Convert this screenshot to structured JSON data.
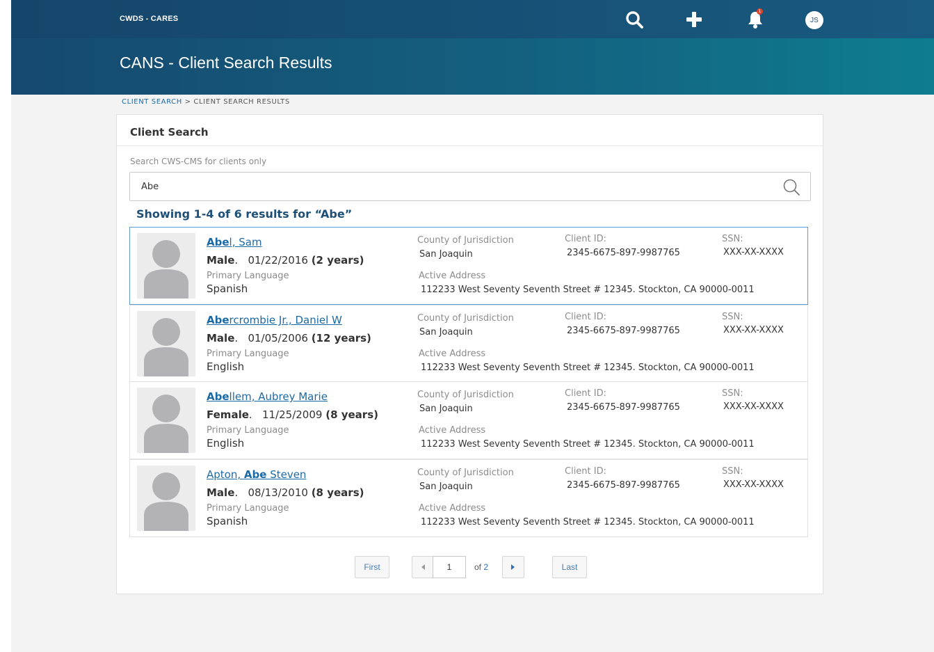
{
  "app": {
    "brand": "CWDS - CARES",
    "user_initials": "JS",
    "notification_count": "1"
  },
  "page": {
    "title": "CANS - Client Search Results"
  },
  "breadcrumb": {
    "link": "CLIENT SEARCH",
    "separator": " > ",
    "current": "CLIENT SEARCH RESULTS"
  },
  "search": {
    "card_title": "Client Search",
    "label": "Search CWS-CMS for clients only",
    "value": "Abe",
    "results_summary": "Showing 1-4 of 6 results for “Abe”"
  },
  "labels": {
    "primary_language": "Primary Language",
    "county": "County of Jurisdiction",
    "client_id": "Client ID:",
    "ssn": "SSN:",
    "address": "Active Address"
  },
  "results": [
    {
      "name_pre": "",
      "name_match": "Abe",
      "name_post": "l, Sam",
      "sex": "Male",
      "dob": "01/22/2016",
      "age": "(2 years)",
      "language": "Spanish",
      "county": "San Joaquin",
      "client_id": "2345-6675-897-9987765",
      "ssn": "XXX-XX-XXXX",
      "address": "112233 West Seventy Seventh Street # 12345. Stockton, CA 90000-0011",
      "selected": true
    },
    {
      "name_pre": "",
      "name_match": "Abe",
      "name_post": "rcrombie Jr., Daniel  W",
      "sex": "Male",
      "dob": "01/05/2006",
      "age": "(12 years)",
      "language": "English",
      "county": "San Joaquin",
      "client_id": "2345-6675-897-9987765",
      "ssn": "XXX-XX-XXXX",
      "address": "112233 West Seventy Seventh Street # 12345. Stockton, CA 90000-0011",
      "selected": false
    },
    {
      "name_pre": "",
      "name_match": "Abe",
      "name_post": "llem, Aubrey Marie",
      "sex": "Female",
      "dob": "11/25/2009",
      "age": "(8 years)",
      "language": "English",
      "county": "San Joaquin",
      "client_id": "2345-6675-897-9987765",
      "ssn": "XXX-XX-XXXX",
      "address": "112233 West Seventy Seventh Street # 12345. Stockton, CA 90000-0011",
      "selected": false
    },
    {
      "name_pre": "Apton, ",
      "name_match": "Abe",
      "name_post": " Steven",
      "sex": "Male",
      "dob": "08/13/2010",
      "age": "(8 years)",
      "language": "Spanish",
      "county": "San Joaquin",
      "client_id": "2345-6675-897-9987765",
      "ssn": "XXX-XX-XXXX",
      "address": "112233 West Seventy Seventh Street # 12345. Stockton, CA 90000-0011",
      "selected": false
    }
  ],
  "pagination": {
    "first": "First",
    "last": "Last",
    "current_page": "1",
    "of_label": "of",
    "total_pages": "2"
  },
  "icons": {
    "search": "search-icon",
    "add": "plus-icon",
    "notifications": "bell-icon",
    "prev": "caret-left-icon",
    "next": "caret-right-icon"
  },
  "colors": {
    "header": "#15456a",
    "link": "#1b6aa6",
    "selected_border": "#5a9ad6",
    "badge": "#e0432e"
  }
}
